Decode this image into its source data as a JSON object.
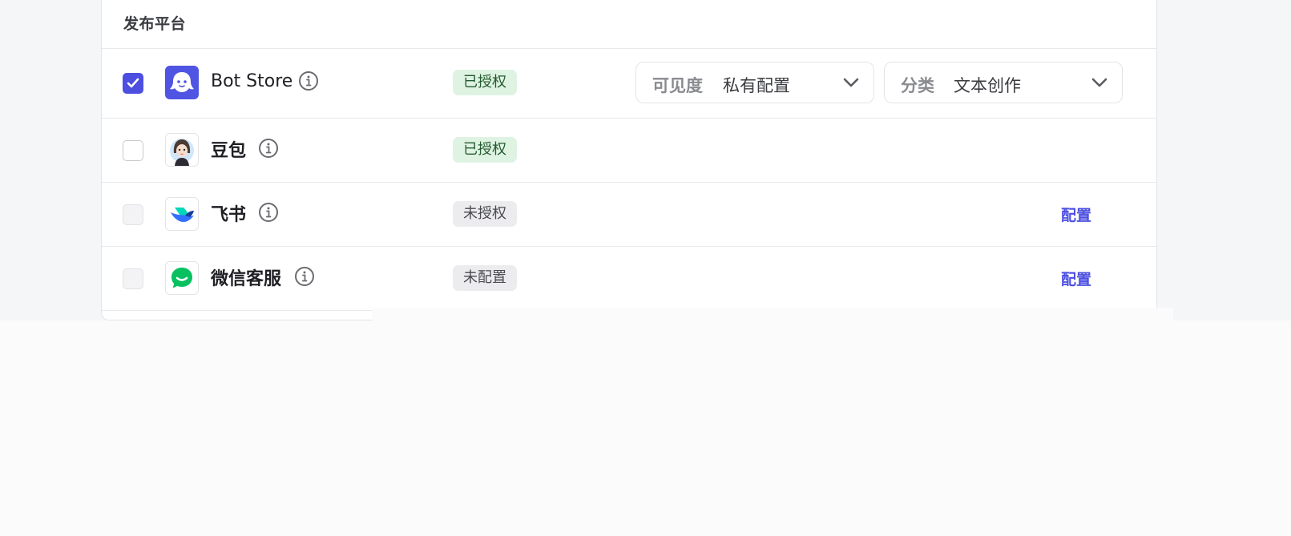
{
  "section": {
    "title": "发布平台"
  },
  "platforms": [
    {
      "name": "Bot Store",
      "checked": true,
      "status": "已授权",
      "visibility": {
        "label": "可见度",
        "value": "私有配置"
      },
      "category": {
        "label": "分类",
        "value": "文本创作"
      }
    },
    {
      "name": "豆包",
      "checked": false,
      "status": "已授权"
    },
    {
      "name": "飞书",
      "checked": false,
      "status": "未授权",
      "action": "配置"
    },
    {
      "name": "微信客服",
      "checked": false,
      "status": "未配置",
      "action": "配置"
    }
  ],
  "colors": {
    "accent": "#4c4fe0",
    "authorized_bg": "#dff3e3",
    "authorized_text": "#245a2e",
    "unauthorized_bg": "#ececee",
    "wechat_green": "#07c160"
  },
  "icons": {
    "bot_store": "bot-store-logo-icon",
    "doubao": "doubao-avatar-icon",
    "feishu": "feishu-bird-icon",
    "wechat": "wechat-customer-service-icon",
    "info": "info-circle-icon",
    "chevron": "chevron-down-icon",
    "check": "check-icon"
  }
}
